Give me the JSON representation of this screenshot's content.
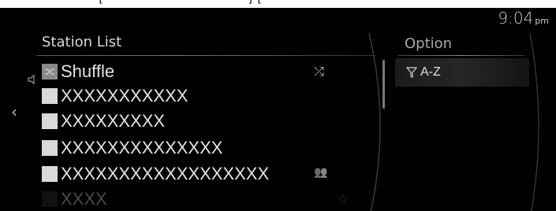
{
  "status": {
    "time": "9:04",
    "ampm": "pm"
  },
  "station_list": {
    "title": "Station List",
    "rows": [
      {
        "label": "Shuffle",
        "trailing_icon": "shuffle-icon",
        "trailing_glyph": "⤮"
      },
      {
        "label": "XXXXXXXXXXX"
      },
      {
        "label": "XXXXXXXXX"
      },
      {
        "label": "XXXXXXXXXXXXXX"
      },
      {
        "label": "XXXXXXXXXXXXXXXXXX",
        "trailing_icon": "people-icon",
        "trailing_glyph": "👥"
      },
      {
        "label": "XXXX",
        "trailing_icon": "star-icon",
        "trailing_glyph": "☆"
      }
    ]
  },
  "option_panel": {
    "title": "Option",
    "items": [
      {
        "label": "A-Z",
        "icon": "filter-icon"
      }
    ]
  },
  "nav": {
    "back_glyph": "‹"
  },
  "colors": {
    "background": "#000000",
    "text": "#e4e4e4",
    "thumb": "#d9d9d9"
  }
}
